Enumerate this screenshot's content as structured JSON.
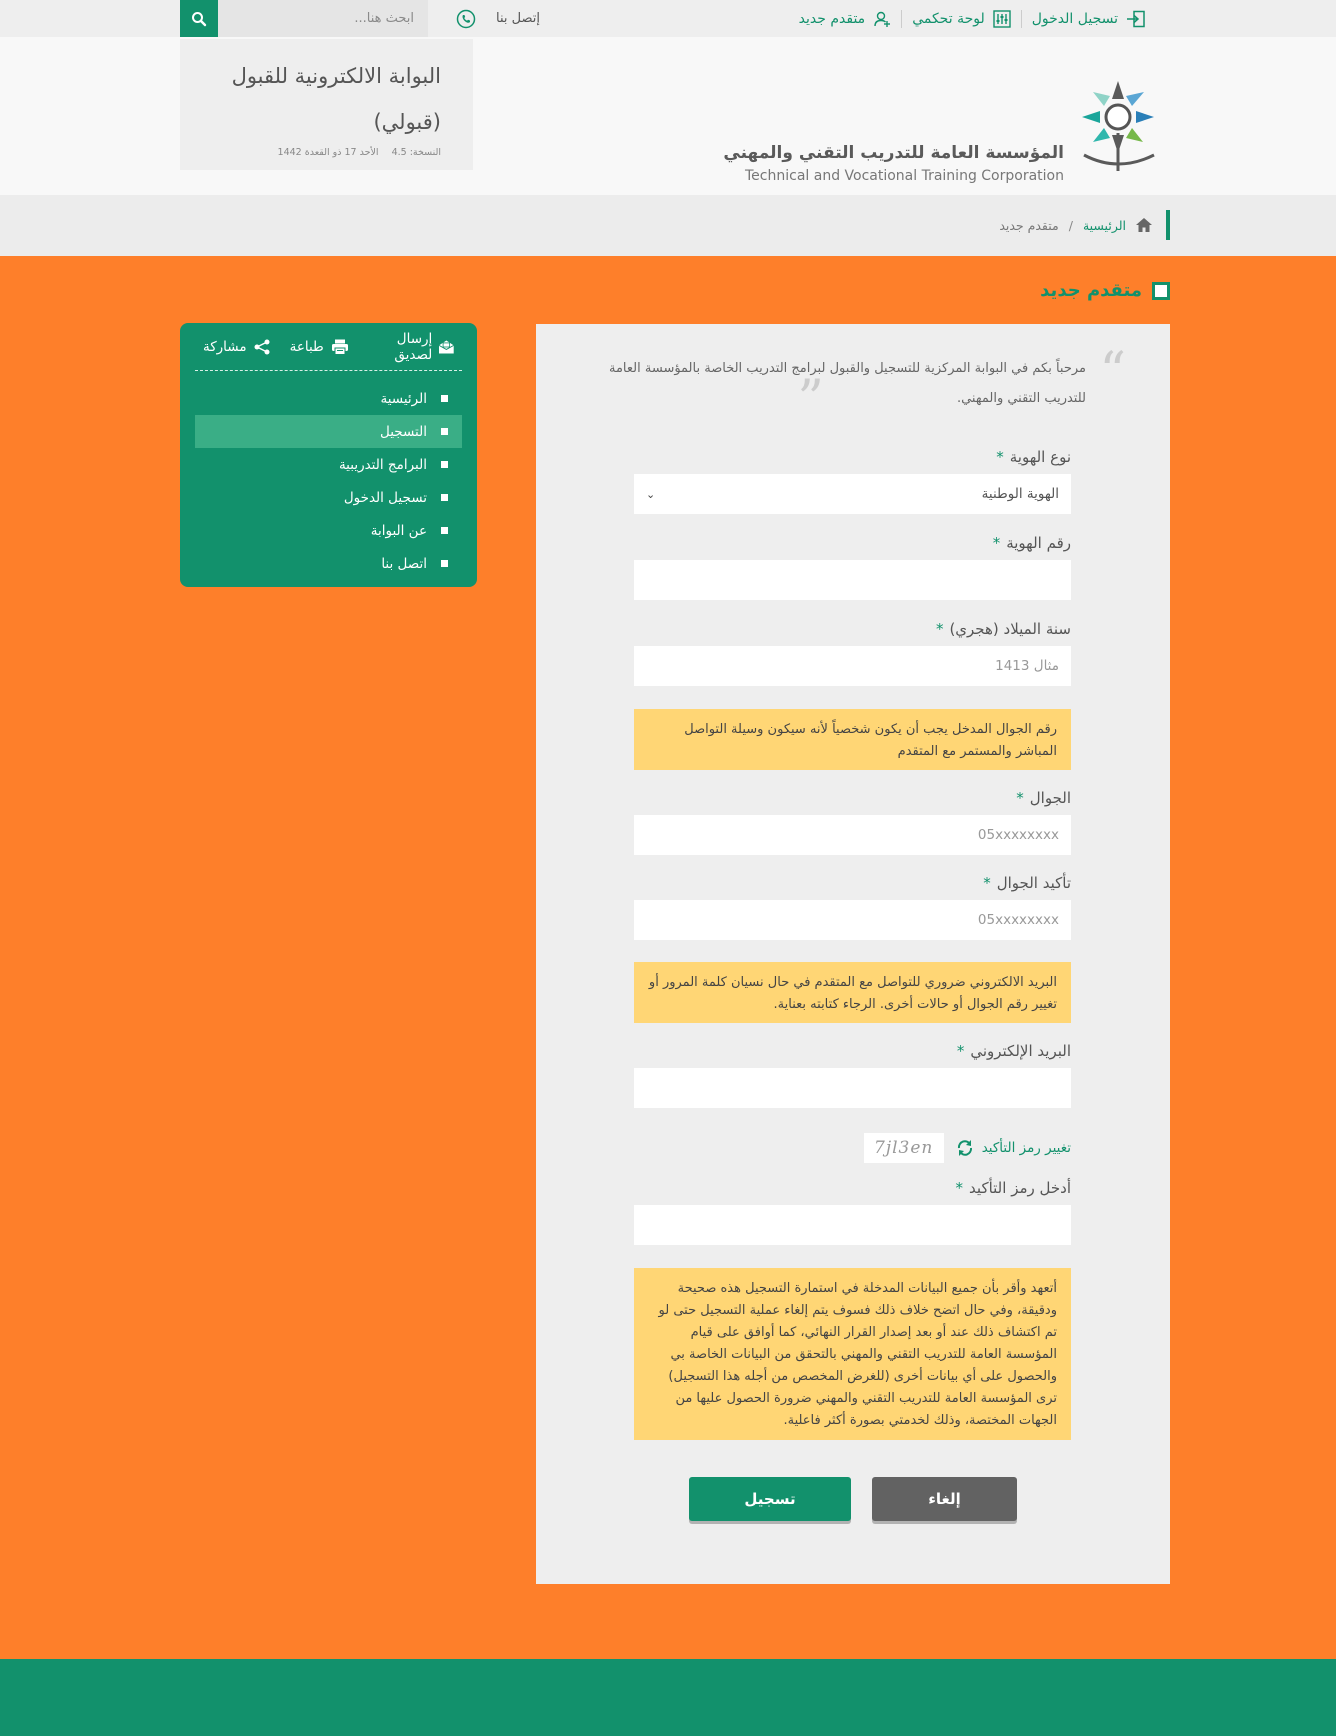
{
  "topbar": {
    "search_placeholder": "ابحث هنا...",
    "contact_label": "إتصل بنا",
    "links": {
      "login": "تسجيل الدخول",
      "dashboard": "لوحة تحكمي",
      "new_applicant": "متقدم جديد"
    }
  },
  "header": {
    "logo_ar": "المؤسسة العامة للتدريب التقني والمهني",
    "logo_en": "Technical and Vocational Training Corporation",
    "portal_title": "البوابة الالكترونية للقبول (قبولي)",
    "version_label": "النسخة: 4.5",
    "date_label": "الأحد 17 ذو القعدة 1442"
  },
  "breadcrumb": {
    "home": "الرئيسية",
    "separator": "/",
    "current": "متقدم جديد"
  },
  "page": {
    "heading": "متقدم جديد"
  },
  "side": {
    "actions": {
      "send": "إرسال لصديق",
      "print": "طباعة",
      "share": "مشاركة"
    },
    "items": [
      {
        "label": "الرئيسية",
        "active": false
      },
      {
        "label": "التسجيل",
        "active": true
      },
      {
        "label": "البرامج التدريبية",
        "active": false
      },
      {
        "label": "تسجيل الدخول",
        "active": false
      },
      {
        "label": "عن البوابة",
        "active": false
      },
      {
        "label": "اتصل بنا",
        "active": false
      }
    ]
  },
  "form": {
    "welcome": "مرحباً بكم في البوابة المركزية للتسجيل والقبول لبرامج التدريب الخاصة بالمؤسسة العامة للتدريب التقني والمهني.",
    "required_mark": "*",
    "id_type": {
      "label": "نوع الهوية",
      "value": "الهوية الوطنية"
    },
    "id_number": {
      "label": "رقم الهوية",
      "placeholder": ""
    },
    "birth_year": {
      "label": "سنة الميلاد (هجري)",
      "placeholder": "مثال 1413"
    },
    "mobile_note": "رقم الجوال المدخل يجب أن يكون شخصياً لأنه سيكون وسيلة التواصل المباشر والمستمر مع المتقدم",
    "mobile": {
      "label": "الجوال",
      "placeholder": "05xxxxxxxx"
    },
    "mobile_confirm": {
      "label": "تأكيد الجوال",
      "placeholder": "05xxxxxxxx"
    },
    "email_note": "البريد الالكتروني ضروري للتواصل مع المتقدم في حال نسيان كلمة المرور أو تغيير رقم الجوال أو حالات أخرى. الرجاء كتابته بعناية.",
    "email": {
      "label": "البريد الإلكتروني",
      "placeholder": ""
    },
    "captcha": {
      "refresh_label": "تغيير رمز التأكيد",
      "code": "7jl3en"
    },
    "captcha_input": {
      "label": "أدخل رمز التأكيد",
      "placeholder": ""
    },
    "pledge": "أتعهد وأقر بأن جميع البيانات المدخلة في استمارة التسجيل هذه صحيحة ودقيقة، وفي حال اتضح خلاف ذلك فسوف يتم إلغاء عملية التسجيل حتى لو تم اكتشاف ذلك عند أو بعد إصدار القرار النهائي، كما أوافق على قيام المؤسسة العامة للتدريب التقني والمهني بالتحقق من البيانات الخاصة بي والحصول على أي بيانات أخرى (للغرض المخصص من أجله هذا التسجيل) ترى المؤسسة العامة للتدريب التقني والمهني ضرورة الحصول عليها من الجهات المختصة، وذلك لخدمتي بصورة أكثر فاعلية.",
    "buttons": {
      "cancel": "إلغاء",
      "submit": "تسجيل"
    }
  },
  "colors": {
    "brand_green": "#12916c",
    "orange_bg": "#fe7f2a",
    "note_yellow": "#ffd675"
  }
}
